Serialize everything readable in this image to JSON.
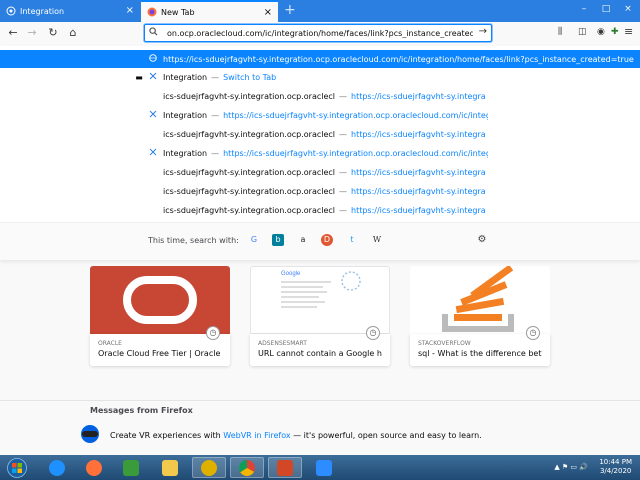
{
  "tabs": [
    {
      "label": "Integration",
      "close": "×"
    },
    {
      "label": "New Tab",
      "close": "×"
    }
  ],
  "new_tab_plus": "+",
  "window_controls": {
    "minimize": "–",
    "maximize": "□",
    "close": "×"
  },
  "nav": {
    "back": "←",
    "forward": "→",
    "reload": "↻",
    "home": "⌂"
  },
  "urlbar": {
    "value": "on.ocp.oraclecloud.com/ic/integration/home/faces/link?pcs_instance_created=true",
    "go": "→"
  },
  "toolbar_icons": {
    "library": "⫼",
    "sidebar": "◫",
    "account": "◉",
    "extension": "✚",
    "menu": "≡"
  },
  "suggestions": [
    {
      "icon": "globe",
      "text": "https://ics-sduejrfagvht-sy.integration.ocp.oraclecloud.com/ic/integration/home/faces/link?pcs_instance_created=true",
      "sep": "",
      "extra": ""
    },
    {
      "icon": "tab",
      "text": "Integration",
      "sep": "—",
      "extra": "Switch to Tab"
    },
    {
      "icon": "",
      "text": "ics-sduejrfagvht-sy.integration.ocp.oraclecloud.com",
      "sep": "—",
      "extra": "https://ics-sduejrfagvht-sy.integration.ocp.oraclecloud.com"
    },
    {
      "icon": "integration",
      "text": "Integration",
      "sep": "—",
      "extra": "https://ics-sduejrfagvht-sy.integration.ocp.oraclecloud.com/ic/integration/home"
    },
    {
      "icon": "",
      "text": "ics-sduejrfagvht-sy.integration.ocp.oraclecloud.com",
      "sep": "—",
      "extra": "https://ics-sduejrfagvht-sy.integration.ocp.oraclecloud.com"
    },
    {
      "icon": "integration",
      "text": "Integration",
      "sep": "—",
      "extra": "https://ics-sduejrfagvht-sy.integration.ocp.oraclecloud.com/ic/integration/home"
    },
    {
      "icon": "",
      "text": "ics-sduejrfagvht-sy.integration.ocp.oraclecloud.com",
      "sep": "—",
      "extra": "https://ics-sduejrfagvht-sy.integration.ocp.oraclecloud.com"
    },
    {
      "icon": "",
      "text": "ics-sduejrfagvht-sy.integration.ocp.oraclecloud.com",
      "sep": "—",
      "extra": "https://ics-sduejrfagvht-sy.integration.ocp.oraclecloud.com"
    },
    {
      "icon": "",
      "text": "ics-sduejrfagvht-sy.integration.ocp.oraclecloud.com",
      "sep": "—",
      "extra": "https://ics-sduejrfagvht-sy.integration.ocp.oraclecloud.com"
    }
  ],
  "search_bar": {
    "label": "This time, search with:",
    "engines": [
      {
        "name": "google",
        "glyph": "G",
        "color": "#4285f4"
      },
      {
        "name": "bing",
        "glyph": "b",
        "color": "#00809d"
      },
      {
        "name": "amazon",
        "glyph": "a",
        "color": "#222222"
      },
      {
        "name": "duckduckgo",
        "glyph": "D",
        "color": "#de5833"
      },
      {
        "name": "twitter",
        "glyph": "t",
        "color": "#1da1f2"
      },
      {
        "name": "wikipedia",
        "glyph": "W",
        "color": "#333333"
      }
    ],
    "settings_glyph": "⚙"
  },
  "top_sites": [
    {
      "source": "ORACLE",
      "title": "Oracle Cloud Free Tier | Oracle"
    },
    {
      "source": "ADSENSESMART",
      "title": "URL cannot contain a Google host"
    },
    {
      "source": "STACKOVERFLOW",
      "title": "sql - What is the difference betwe..."
    }
  ],
  "clock_glyph": "◷",
  "messages": {
    "title": "Messages from Firefox",
    "text_before": "Create VR experiences with ",
    "link": "WebVR in Firefox",
    "text_after": " — it's powerful, open source and easy to learn."
  },
  "taskbar": {
    "time": "10:44 PM",
    "date": "3/4/2020",
    "tray": "▲ ⚑ ▭ 🔊"
  },
  "colors": {
    "accent": "#0a84ff",
    "oracle_red": "#c74634"
  }
}
